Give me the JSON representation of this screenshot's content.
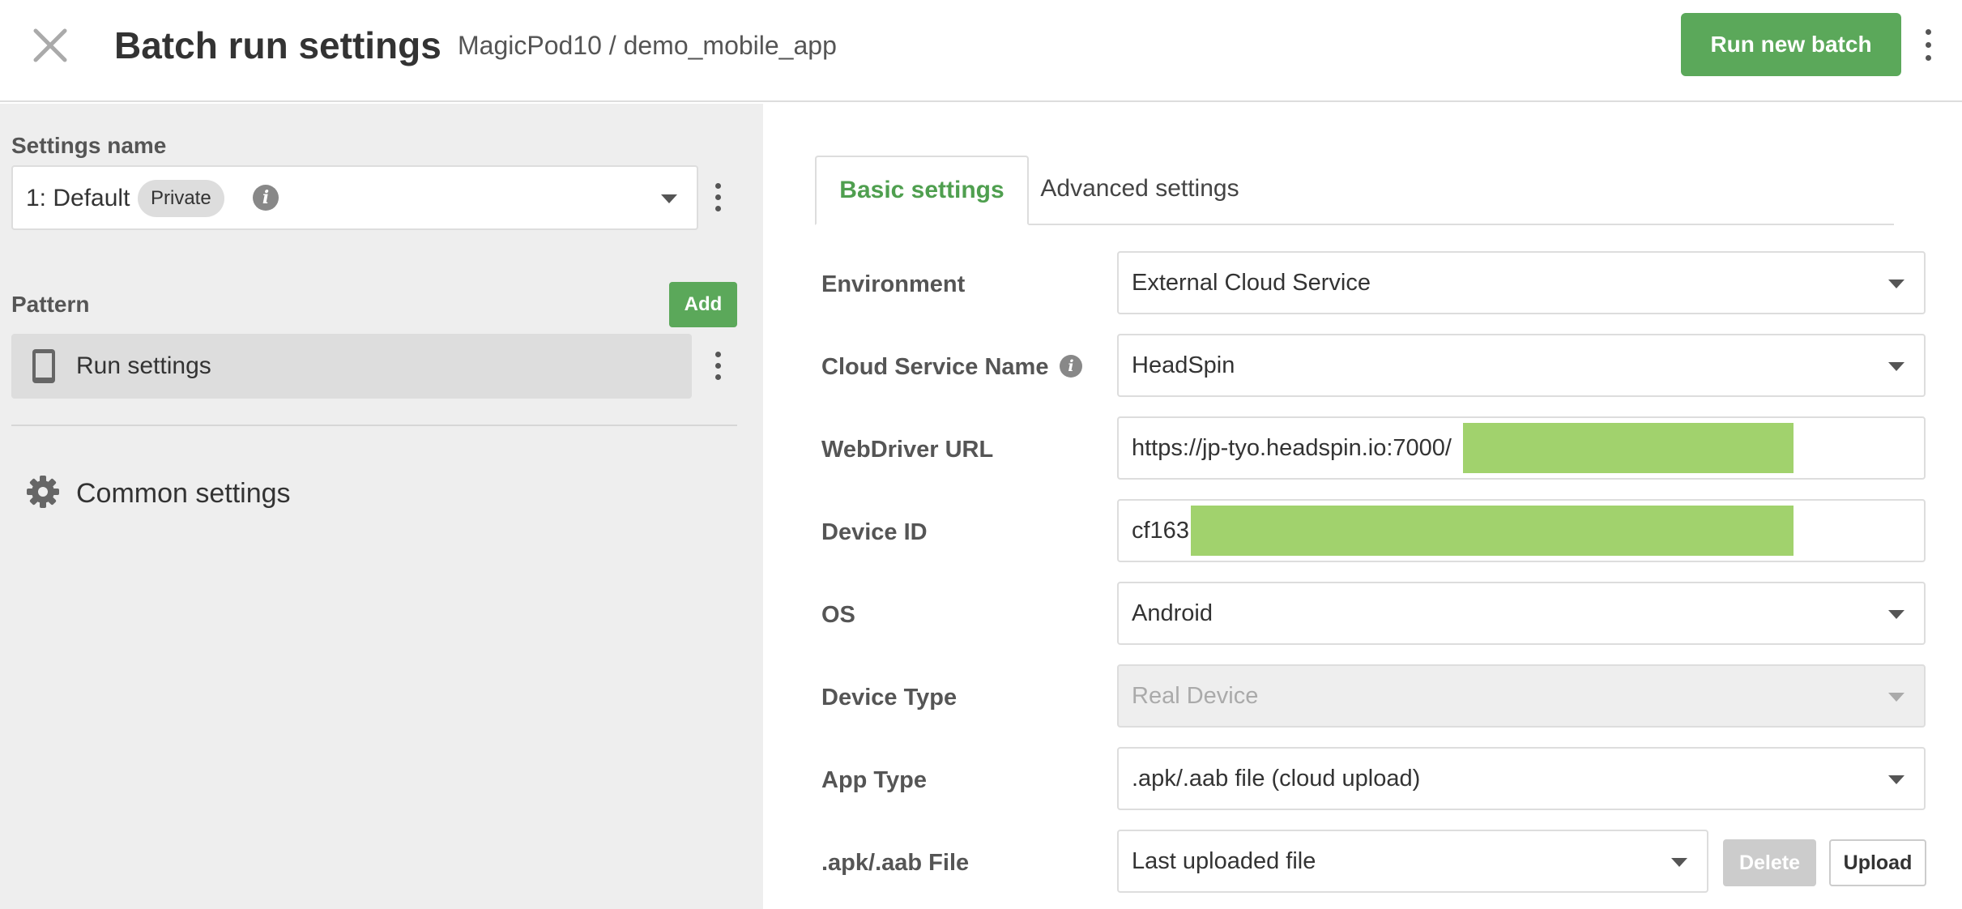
{
  "header": {
    "title": "Batch run settings",
    "breadcrumb": "MagicPod10 / demo_mobile_app",
    "run_button": "Run new batch",
    "close_icon": "close-icon",
    "menu_icon": "kebab-menu-icon"
  },
  "left": {
    "settings_name_label": "Settings name",
    "settings_select": {
      "value": "1: Default",
      "badge": "Private"
    },
    "pattern_label": "Pattern",
    "add_button": "Add",
    "pattern_items": [
      {
        "label": "Run settings",
        "icon": "mobile-phone-icon"
      }
    ],
    "common_settings": {
      "label": "Common settings",
      "icon": "gear-icon"
    }
  },
  "tabs": [
    {
      "label": "Basic settings",
      "active": true
    },
    {
      "label": "Advanced settings",
      "active": false
    }
  ],
  "fields": {
    "environment": {
      "label": "Environment",
      "value": "External Cloud Service"
    },
    "cloud_service": {
      "label": "Cloud Service Name",
      "value": "HeadSpin"
    },
    "webdriver_url": {
      "label": "WebDriver URL",
      "value": "https://jp-tyo.headspin.io:7000/"
    },
    "device_id": {
      "label": "Device ID",
      "value": "cf163"
    },
    "os": {
      "label": "OS",
      "value": "Android"
    },
    "device_type": {
      "label": "Device Type",
      "value": "Real Device",
      "disabled": true
    },
    "app_type": {
      "label": "App Type",
      "value": ".apk/.aab file (cloud upload)"
    },
    "apk_file": {
      "label": ".apk/.aab File",
      "value": "Last uploaded file",
      "delete_button": "Delete",
      "upload_button": "Upload"
    }
  },
  "colors": {
    "accent_green": "#5ba85a",
    "tab_active_text": "#4f9f4f",
    "left_panel_bg": "#eeeeee",
    "redaction": "#a1d26d"
  }
}
